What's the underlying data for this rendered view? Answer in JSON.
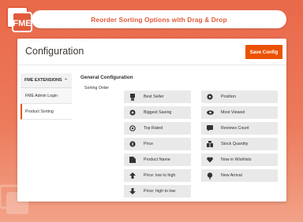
{
  "banner": {
    "title": "Reorder Sorting Options with Drag & Drop"
  },
  "logo": {
    "letters": "FME"
  },
  "header": {
    "page_title": "Configuration",
    "save_label": "Save Config"
  },
  "sidebar": {
    "group_label": "FME EXTENSIONS",
    "items": [
      {
        "label": "FME Admin Login",
        "active": false
      },
      {
        "label": "Product Sorting",
        "active": true
      }
    ]
  },
  "main": {
    "section_title": "General Configuration",
    "sort_order_label": "Sorting Order",
    "left_options": [
      {
        "label": "Best Seller",
        "icon": "bestseller-icon"
      },
      {
        "label": "Biggest Saving",
        "icon": "saving-icon"
      },
      {
        "label": "Top Rated",
        "icon": "top-rated-icon"
      },
      {
        "label": "Price",
        "icon": "price-icon"
      },
      {
        "label": "Product Name",
        "icon": "product-name-icon"
      },
      {
        "label": "Price: low to high",
        "icon": "price-low-high-icon"
      },
      {
        "label": "Price: high to low",
        "icon": "price-high-low-icon"
      }
    ],
    "right_options": [
      {
        "label": "Position",
        "icon": "position-icon"
      },
      {
        "label": "Most Viewed",
        "icon": "eye-icon"
      },
      {
        "label": "Reviews Count",
        "icon": "reviews-icon"
      },
      {
        "label": "Stock Quantity",
        "icon": "stock-icon"
      },
      {
        "label": "Now in Wishlists",
        "icon": "heart-icon"
      },
      {
        "label": "New Arrival",
        "icon": "new-arrival-icon"
      }
    ]
  },
  "colors": {
    "accent": "#eb5202",
    "banner_text": "#e25b3a",
    "background": "#ec7a5b"
  }
}
